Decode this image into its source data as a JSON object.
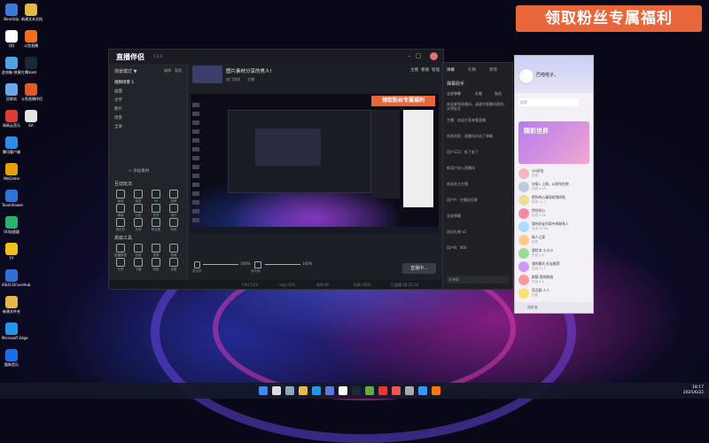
{
  "desktop": {
    "icons": [
      {
        "label": "Bandizip",
        "color": "#3a7bd5"
      },
      {
        "label": "QQ",
        "color": "#ffffff"
      },
      {
        "label": "此电脑-快捷方式",
        "color": "#4fa3e0"
      },
      {
        "label": "回收站",
        "color": "#6aa9e9"
      },
      {
        "label": "网易云音乐",
        "color": "#e03a3a"
      },
      {
        "label": "腾讯客户端",
        "color": "#2e8be6"
      },
      {
        "label": "WeGame",
        "color": "#e2a100"
      },
      {
        "label": "TeamViewer",
        "color": "#2c74d8"
      },
      {
        "label": "UU加速器",
        "color": "#28b26c"
      },
      {
        "label": "YY",
        "color": "#f0c020"
      },
      {
        "label": "ASUS DriverHub",
        "color": "#2d6fd6"
      },
      {
        "label": "新建文件夹",
        "color": "#e3b74a"
      },
      {
        "label": "Microsoft Edge",
        "color": "#2596e6"
      },
      {
        "label": "酷狗音乐",
        "color": "#1a6ee8"
      }
    ],
    "icons_col2": [
      {
        "label": "新建文本文档",
        "color": "#e3b74a"
      },
      {
        "label": "斗鱼直播",
        "color": "#f07020"
      },
      {
        "label": "Steam",
        "color": "#1b2838"
      },
      {
        "label": "斗鱼直播伴侣",
        "color": "#e05a2a"
      },
      {
        "label": "EA",
        "color": "#e5e5e5"
      }
    ]
  },
  "banner": {
    "text": "领取粉丝专属福利",
    "color": "#e8663a"
  },
  "app": {
    "logo": "直播伴侣",
    "version": "5.0.0",
    "stream_title": "图片素材分享的男人!",
    "category_tags": [
      "热门游戏",
      "主播"
    ],
    "right_tabs": [
      "主播",
      "看播",
      "管理"
    ],
    "left": {
      "scene_header": "场景模式 ▼",
      "scene_actions": [
        "编辑",
        "管理"
      ],
      "scene_items": [
        "视频场景 1",
        "画面",
        "文字",
        "图片",
        "场景",
        "全屏"
      ],
      "add_source": "+ 添加素材",
      "interaction_title": "互动玩法",
      "interaction_tools": [
        "抽奖",
        "连麦",
        "PK",
        "投票",
        "弹幕",
        "公告",
        "任务",
        "排行",
        "抢红包",
        "礼物",
        "粉丝团",
        "特效"
      ],
      "advanced_title": "高级工具",
      "advanced_tools": [
        "直播数据",
        "回放",
        "录屏",
        "剪辑",
        "分享",
        "下播",
        "转推",
        "设置"
      ],
      "more": "更多功能"
    },
    "preview_banner": "领取粉丝专属福利",
    "audio": [
      {
        "label": "麦克风",
        "value": "100%"
      },
      {
        "label": "扬声器",
        "value": "100%"
      }
    ],
    "live_button": "直播中...",
    "status": [
      "CPU:12%",
      "内存:45%",
      "帧率:60",
      "码率:3500",
      "已直播 00:12:34"
    ]
  },
  "chat": {
    "tabs": [
      "弹幕",
      "礼物",
      "贵宾"
    ],
    "header": "弹幕助手",
    "subtabs": [
      "全部弹幕",
      "礼物",
      "私信"
    ],
    "messages": [
      "欢迎来到直播间，请遵守直播间规则，文明发言",
      "主播：欢迎大家来看直播",
      "系统消息：直播间开启了弹幕",
      "用户123：来了来了",
      "新用户进入直播间",
      "欢迎关注主播",
      "用户A：主播好厉害",
      "全部弹幕",
      "送出礼物 x1",
      "用户B：666"
    ],
    "input_placeholder": "发弹幕"
  },
  "qq": {
    "name": "巴啦啦子。",
    "search_placeholder": "搜索",
    "hero": "精彩世界",
    "friends": [
      {
        "name": "QQ好友",
        "sub": "在线",
        "color": "#f5b7c7"
      },
      {
        "name": "分组1 上线，以你所在地",
        "sub": "在线 9.18",
        "color": "#bcd"
      },
      {
        "name": "把你的心事说给我听啦",
        "sub": "在线 11.7",
        "color": "#ed9"
      },
      {
        "name": "特别关心",
        "sub": "在线 3.28",
        "color": "#f8a"
      },
      {
        "name": "我的好友列表中的联系人",
        "sub": "在线 23.56",
        "color": "#adf"
      },
      {
        "name": "新人之家",
        "sub": "在线",
        "color": "#fc8"
      },
      {
        "name": "冒险岛 小小小",
        "sub": "在线 2.8",
        "color": "#9d9"
      },
      {
        "name": "我的聊天 好友推荐",
        "sub": "在线 22.1",
        "color": "#c9f"
      },
      {
        "name": "群聊 我的群组",
        "sub": "在线 4.5",
        "color": "#f99"
      },
      {
        "name": "西北群 人人",
        "sub": "在线",
        "color": "#fd7"
      }
    ],
    "bottom": "加好友"
  },
  "taskbar": {
    "time": "18:17",
    "date": "2025/6/22",
    "icons": [
      "start",
      "search",
      "taskview",
      "explorer",
      "edge",
      "store",
      "qq",
      "steam",
      "game",
      "browser",
      "music",
      "settings",
      "mail",
      "douyu"
    ]
  }
}
